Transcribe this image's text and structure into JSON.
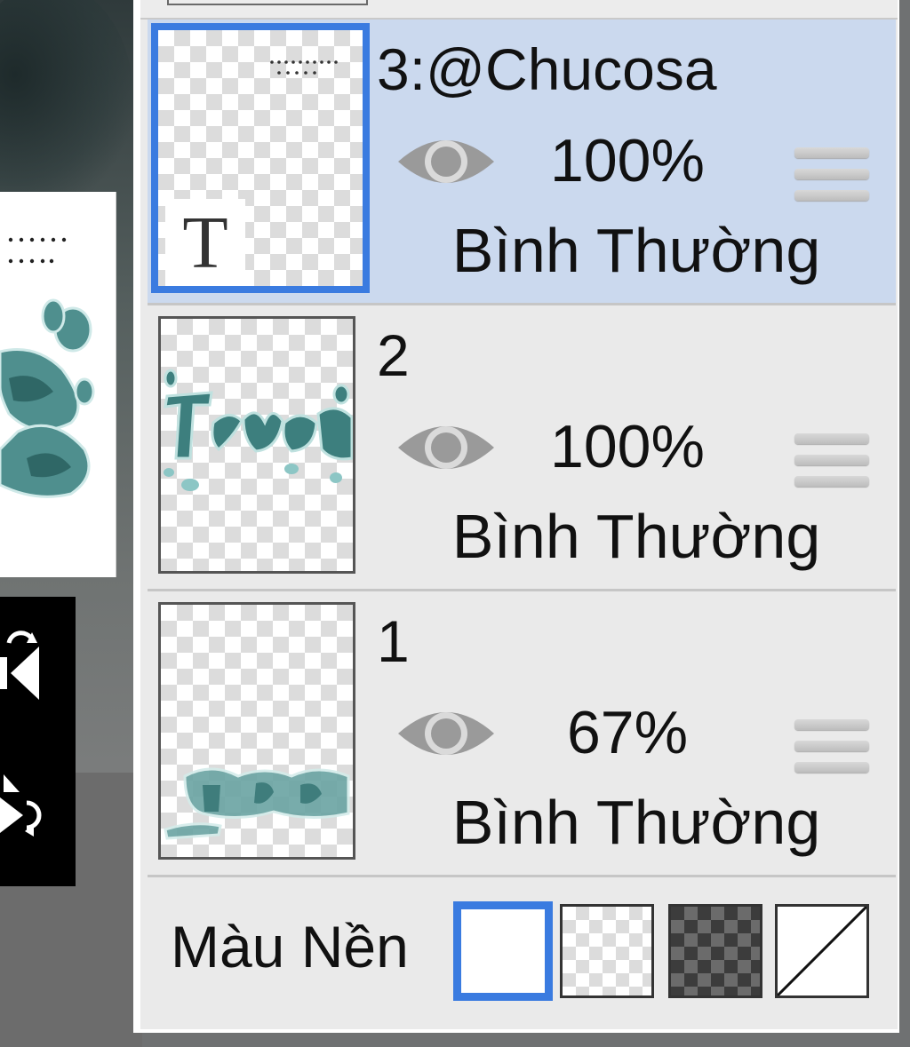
{
  "layers": [
    {
      "name": "3:@Chucosa",
      "opacity": "100%",
      "blend_mode": "Bình Thường",
      "selected": true,
      "type": "text",
      "type_glyph": "T"
    },
    {
      "name": "2",
      "opacity": "100%",
      "blend_mode": "Bình Thường",
      "selected": false,
      "type": "image"
    },
    {
      "name": "1",
      "opacity": "67%",
      "blend_mode": "Bình Thường",
      "selected": false,
      "type": "image"
    }
  ],
  "background": {
    "label": "Màu Nền",
    "options": [
      "white",
      "transparent",
      "dark-checker",
      "white-black-split"
    ],
    "selected": "white"
  },
  "colors": {
    "accent": "#3a7be0",
    "selected_row": "#cbd9ee",
    "panel_bg": "#eaeaea",
    "eye_icon": "#9a9a9a",
    "artwork_teal": "#4f8f8e"
  }
}
